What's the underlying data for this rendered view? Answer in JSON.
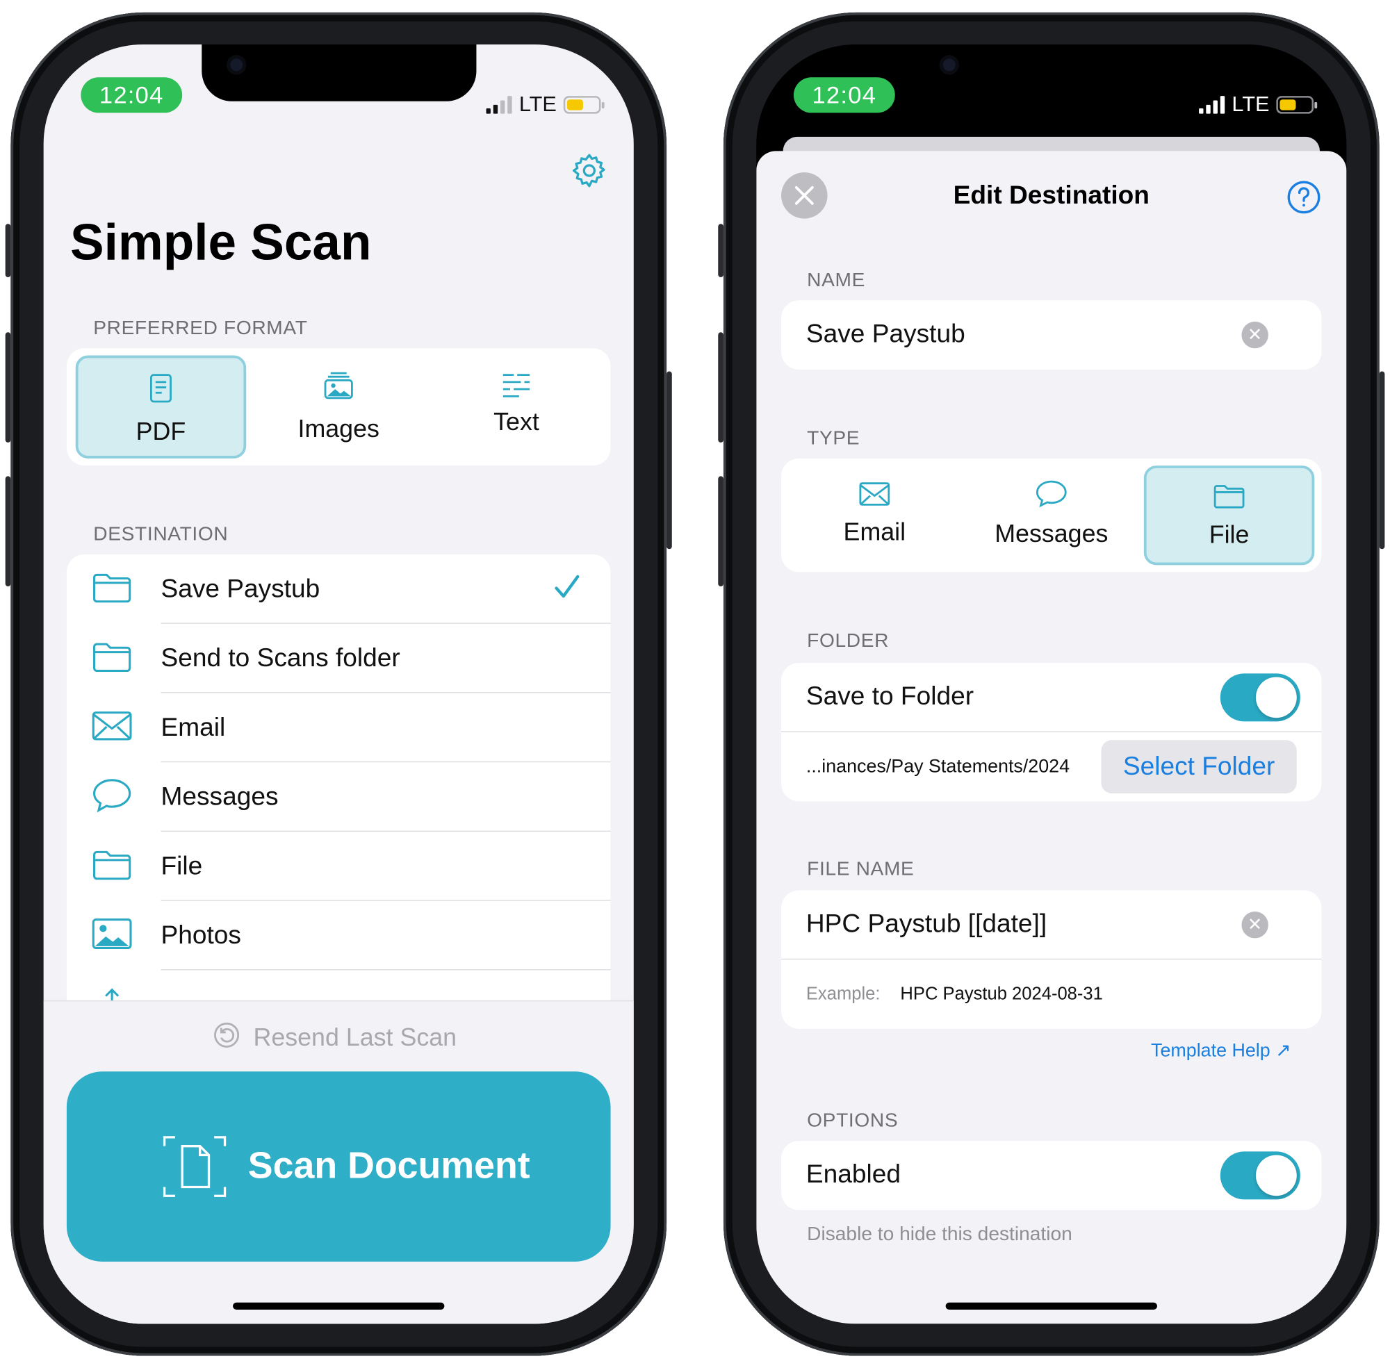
{
  "status": {
    "time": "12:04",
    "network": "LTE"
  },
  "left": {
    "title": "Simple Scan",
    "preferred_format_label": "PREFERRED FORMAT",
    "formats": [
      {
        "label": "PDF",
        "icon": "pdf-document-icon",
        "selected": true
      },
      {
        "label": "Images",
        "icon": "images-icon",
        "selected": false
      },
      {
        "label": "Text",
        "icon": "text-lines-icon",
        "selected": false
      }
    ],
    "destination_label": "DESTINATION",
    "destinations": [
      {
        "label": "Save Paystub",
        "icon": "folder-icon",
        "checked": true
      },
      {
        "label": "Send to Scans folder",
        "icon": "folder-icon",
        "checked": false
      },
      {
        "label": "Email",
        "icon": "envelope-icon",
        "checked": false
      },
      {
        "label": "Messages",
        "icon": "message-bubble-icon",
        "checked": false
      },
      {
        "label": "File",
        "icon": "folder-icon",
        "checked": false
      },
      {
        "label": "Photos",
        "icon": "photo-icon",
        "checked": false
      }
    ],
    "resend_label": "Resend Last Scan",
    "scan_button_label": "Scan Document"
  },
  "right": {
    "title": "Edit Destination",
    "name_label": "NAME",
    "name_value": "Save Paystub",
    "type_label": "TYPE",
    "types": [
      {
        "label": "Email",
        "icon": "envelope-icon",
        "selected": false
      },
      {
        "label": "Messages",
        "icon": "message-bubble-icon",
        "selected": false
      },
      {
        "label": "File",
        "icon": "folder-icon",
        "selected": true
      }
    ],
    "folder_label": "FOLDER",
    "save_to_folder_label": "Save to Folder",
    "save_to_folder_on": true,
    "folder_path": "...inances/Pay Statements/2024",
    "select_folder_label": "Select Folder",
    "file_name_label": "FILE NAME",
    "file_name_value": "HPC Paystub [[date]]",
    "example_label": "Example:",
    "example_value": "HPC Paystub 2024-08-31",
    "template_help_label": "Template Help ↗",
    "options_label": "OPTIONS",
    "enabled_label": "Enabled",
    "enabled_on": true,
    "enabled_hint": "Disable to hide this destination"
  },
  "colors": {
    "accent": "#2aa9c4",
    "scan_button": "#2faec8",
    "time_pill": "#2fc157",
    "link_blue": "#1a7fe0"
  }
}
